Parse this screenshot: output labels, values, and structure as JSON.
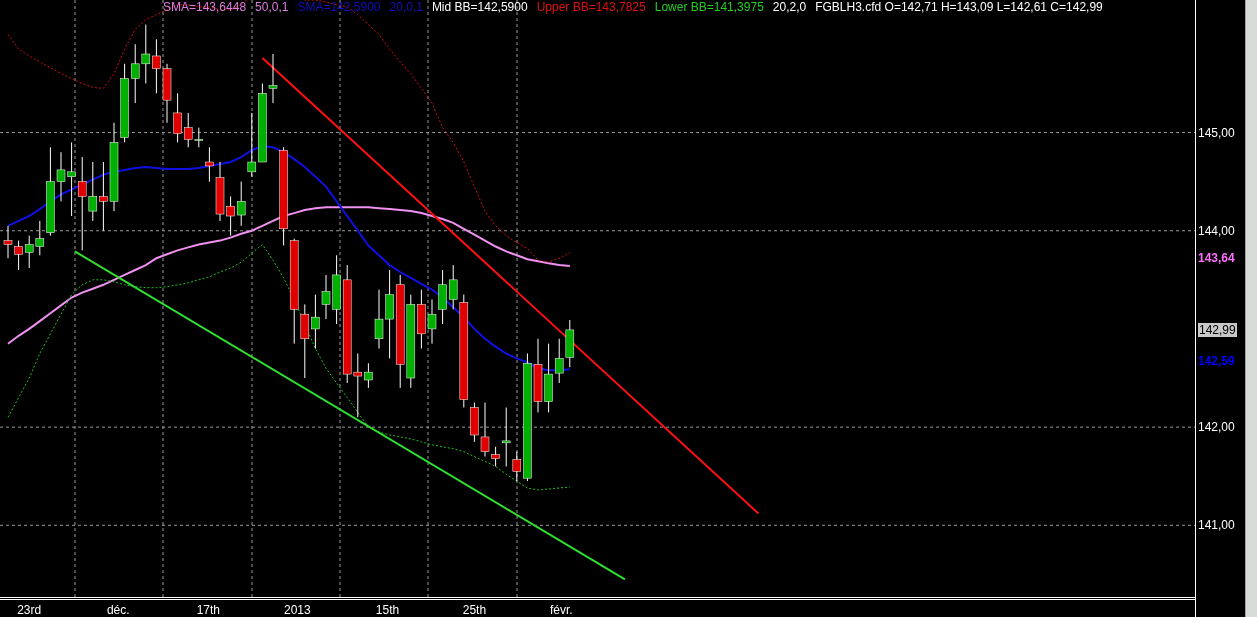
{
  "legend": [
    {
      "text": "SMA=143,6448",
      "color": "#e07ce0"
    },
    {
      "text": "50,0,1",
      "color": "#e07ce0"
    },
    {
      "text": "SMA=142,5900",
      "color": "#1010c0"
    },
    {
      "text": "20,0,1",
      "color": "#1010c0"
    },
    {
      "text": "Mid BB=142,5900",
      "color": "#ffffff"
    },
    {
      "text": "Upper BB=143,7825",
      "color": "#e01010"
    },
    {
      "text": "Lower BB=141,3975",
      "color": "#20d020"
    },
    {
      "text": "20,2,0",
      "color": "#ffffff"
    },
    {
      "text": "FGBLH3.cfd O=142,71 H=143,09 L=142,61 C=142,99",
      "color": "#ffffff"
    }
  ],
  "price_axis": {
    "labels": [
      "145,00",
      "144,00",
      "142,00",
      "141,00"
    ],
    "tags": [
      {
        "text": "143,64",
        "kind": "indicator",
        "color": "#ff70ff"
      },
      {
        "text": "142,99",
        "kind": "last_price"
      },
      {
        "text": "142,59",
        "kind": "indicator",
        "color": "#0000ff"
      }
    ]
  },
  "date_axis": {
    "labels": [
      "23rd",
      "déc.",
      "17th",
      "2013",
      "15th",
      "25th",
      "févr."
    ]
  }
}
